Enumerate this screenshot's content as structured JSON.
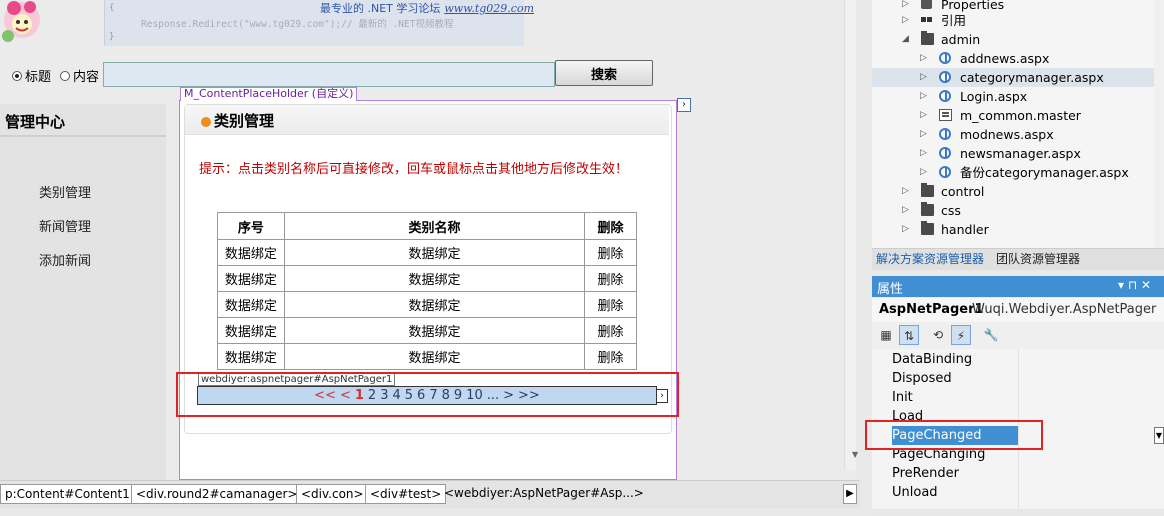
{
  "banner": {
    "code_line": "Response.Redirect(\"www.tg029.com\");// 最新的 .NET视频教程",
    "tagline": "最专业的 .NET 学习论坛",
    "url": "www.tg029.com"
  },
  "search": {
    "radio_title": "标题",
    "radio_content": "内容",
    "input_value": "",
    "button_label": "搜索"
  },
  "left": {
    "title": "管理中心",
    "links": [
      "类别管理",
      "新闻管理",
      "添加新闻"
    ]
  },
  "content_placeholder": {
    "label": "M_ContentPlaceHolder (自定义)"
  },
  "box": {
    "title": "类别管理",
    "tip": "提示：点击类别名称后可直接修改，回车或鼠标点击其他地方后修改生效！"
  },
  "grid": {
    "headers": [
      "序号",
      "类别名称",
      "删除"
    ],
    "rows": [
      [
        "数据绑定",
        "数据绑定",
        "删除"
      ],
      [
        "数据绑定",
        "数据绑定",
        "删除"
      ],
      [
        "数据绑定",
        "数据绑定",
        "删除"
      ],
      [
        "数据绑定",
        "数据绑定",
        "删除"
      ],
      [
        "数据绑定",
        "数据绑定",
        "删除"
      ]
    ]
  },
  "pager": {
    "tag": "webdiyer:aspnetpager#AspNetPager1",
    "first": "<<",
    "prev": "<",
    "pages": [
      "1",
      "2",
      "3",
      "4",
      "5",
      "6",
      "7",
      "8",
      "9",
      "10"
    ],
    "ellipsis": "...",
    "next": ">",
    "last": ">>"
  },
  "tagbar": {
    "crumbs": [
      "p:Content#Content1>",
      "<div.round2#camanager>",
      "<div.con>",
      "<div#test>",
      "<webdiyer:AspNetPager#Asp...>"
    ]
  },
  "solution_explorer": {
    "items": [
      {
        "label": "Properties",
        "icon": "properties-icon",
        "indent": 0,
        "arrow": "collapsed"
      },
      {
        "label": "引用",
        "icon": "references-icon",
        "indent": 0,
        "arrow": "collapsed"
      },
      {
        "label": "admin",
        "icon": "folder-icon",
        "indent": 0,
        "arrow": "expanded"
      },
      {
        "label": "addnews.aspx",
        "icon": "web-page-icon",
        "indent": 1,
        "arrow": "collapsed"
      },
      {
        "label": "categorymanager.aspx",
        "icon": "web-page-icon",
        "indent": 1,
        "arrow": "collapsed",
        "selected": true
      },
      {
        "label": "Login.aspx",
        "icon": "web-page-icon",
        "indent": 1,
        "arrow": "collapsed"
      },
      {
        "label": "m_common.master",
        "icon": "master-page-icon",
        "indent": 1,
        "arrow": "collapsed"
      },
      {
        "label": "modnews.aspx",
        "icon": "web-page-icon",
        "indent": 1,
        "arrow": "collapsed"
      },
      {
        "label": "newsmanager.aspx",
        "icon": "web-page-icon",
        "indent": 1,
        "arrow": "collapsed"
      },
      {
        "label": "备份categorymanager.aspx",
        "icon": "web-page-icon",
        "indent": 1,
        "arrow": "collapsed"
      },
      {
        "label": "control",
        "icon": "folder-icon",
        "indent": 0,
        "arrow": "collapsed"
      },
      {
        "label": "css",
        "icon": "folder-icon",
        "indent": 0,
        "arrow": "collapsed"
      },
      {
        "label": "handler",
        "icon": "folder-icon",
        "indent": 0,
        "arrow": "collapsed"
      }
    ],
    "tabs": [
      "解决方案资源管理器",
      "团队资源管理器"
    ]
  },
  "properties": {
    "title": "属性",
    "controls": "▾ ⊓ ✕",
    "object_name": "AspNetPager1",
    "object_type": "Wuqi.Webdiyer.AspNetPager",
    "events": [
      "DataBinding",
      "Disposed",
      "Init",
      "Load",
      "PageChanged",
      "PageChanging",
      "PreRender",
      "Unload"
    ],
    "selected_event": "PageChanged"
  },
  "colors": {
    "accent": "#3f8fd2",
    "highlight_box": "#e02424",
    "tip_text": "#c00000",
    "pager_bg": "#c0d7f0"
  }
}
